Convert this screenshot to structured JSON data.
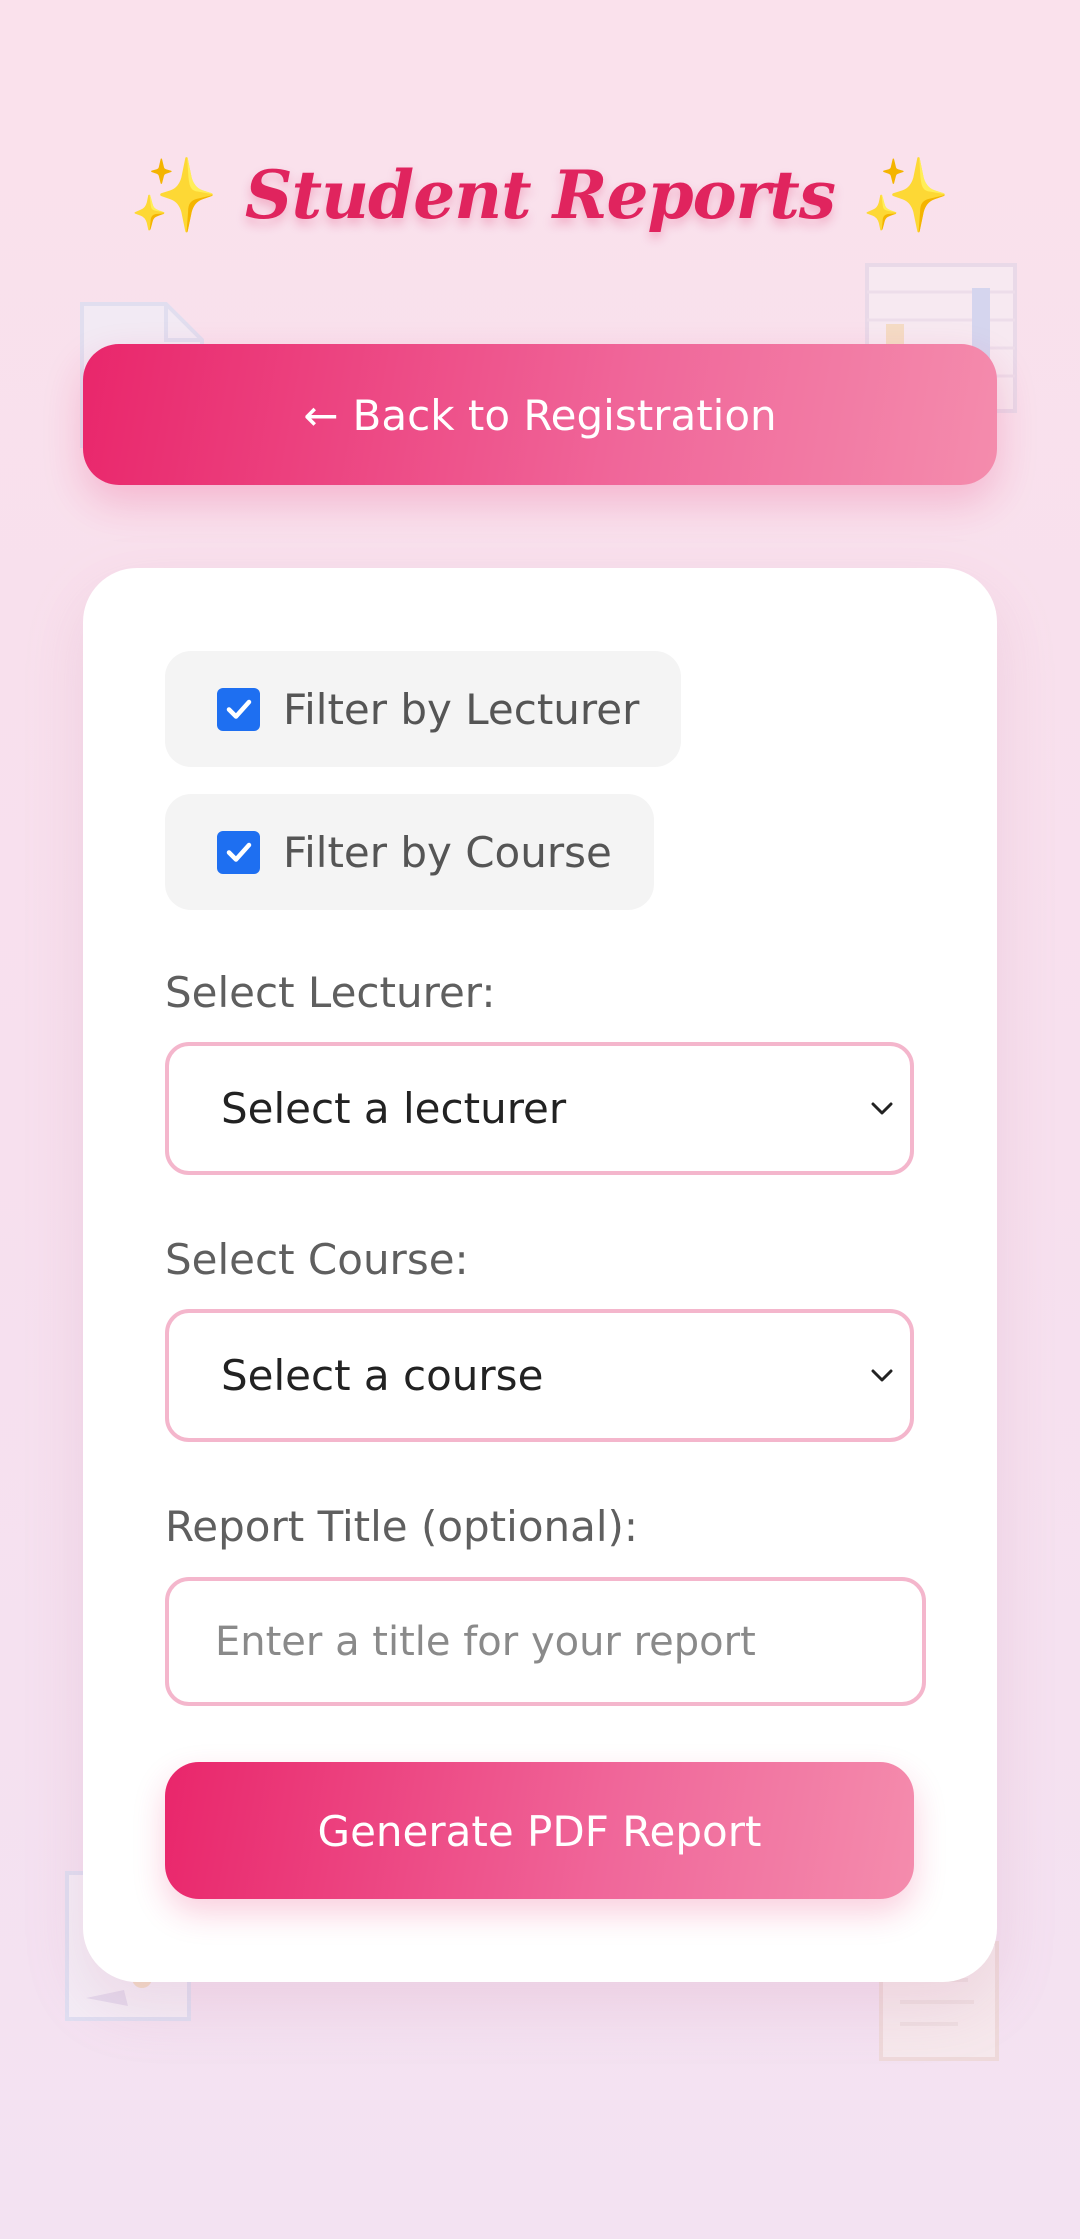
{
  "header": {
    "title": "Student Reports",
    "sparkle_left": "✨",
    "sparkle_right": "✨"
  },
  "back_button": {
    "arrow": "←",
    "label": "Back to Registration"
  },
  "filters": [
    {
      "label": "Filter by Lecturer",
      "checked": true
    },
    {
      "label": "Filter by Course",
      "checked": true
    }
  ],
  "lecturer": {
    "label": "Select Lecturer:",
    "selected": "Select a lecturer"
  },
  "course": {
    "label": "Select Course:",
    "selected": "Select a course"
  },
  "report_title": {
    "label": "Report Title (optional):",
    "value": "",
    "placeholder": "Enter a title for your report"
  },
  "generate_button": {
    "label": "Generate PDF Report"
  },
  "colors": {
    "accent": "#e0245e",
    "checkbox": "#1e6ff1",
    "input_border": "#f4b6cc",
    "label_text": "#5f5f5f"
  },
  "icons": {
    "title_decoration": "sparkles-icon",
    "checkbox": "checkmark-icon",
    "select": "chevron-down-icon",
    "background": [
      "document-icon",
      "spreadsheet-icon",
      "report-icon"
    ]
  }
}
